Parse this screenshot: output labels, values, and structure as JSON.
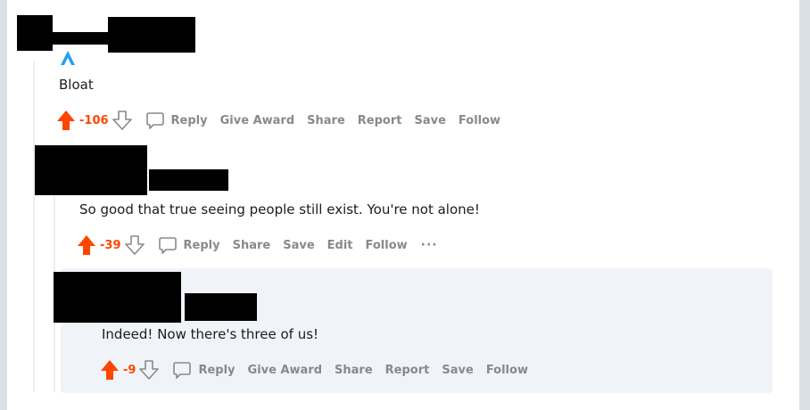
{
  "colors": {
    "upvote": "#ff4500",
    "action_text": "#878a8c",
    "flair": "#24a0ed"
  },
  "comments": [
    {
      "body": "Bloat",
      "score": "-106",
      "actions": [
        "Reply",
        "Give Award",
        "Share",
        "Report",
        "Save",
        "Follow"
      ]
    },
    {
      "body": "So good that true seeing people still exist. You're not alone!",
      "score": "-39",
      "actions": [
        "Reply",
        "Share",
        "Save",
        "Edit",
        "Follow"
      ],
      "more": "···"
    },
    {
      "body": "Indeed! Now there's three of us!",
      "score": "-9",
      "actions": [
        "Reply",
        "Give Award",
        "Share",
        "Report",
        "Save",
        "Follow"
      ]
    }
  ],
  "icons": [
    "arrow-up-icon",
    "arrow-down-icon",
    "comment-bubble-icon",
    "flair-icon",
    "more-icon"
  ]
}
